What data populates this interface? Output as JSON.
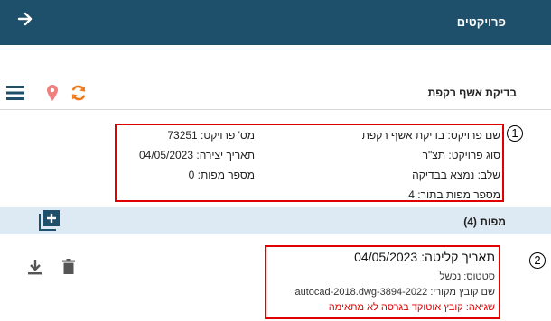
{
  "header": {
    "title": "פרויקטים",
    "nav_icon": "arrow-right-icon"
  },
  "project": {
    "title": "בדיקת אשף רקפת",
    "icons": [
      "menu-icon",
      "location-pin-icon",
      "refresh-icon"
    ]
  },
  "info": {
    "badge": "1",
    "name": "שם פרויקט: בדיקת אשף רקפת",
    "number": "מס' פרויקט: 73251",
    "type": "סוג פרויקט: תצ\"ר",
    "created": "תאריך יצירה: 04/05/2023",
    "stage": "שלב: נמצא בבדיקה",
    "maps_count": "מספר מפות: 0",
    "queued_maps": "מספר מפות בתור: 4"
  },
  "maps": {
    "label": "מפות (4)",
    "add_icon": "add-layer-icon"
  },
  "file": {
    "badge": "2",
    "date": "תאריך קליטה: 04/05/2023",
    "status": "סטטוס: נכשל",
    "source": "שם קובץ מקורי: autocad-2018.dwg-3894-2022",
    "error": "שגיאה: קובץ אוטוקד בגרסה לא מתאימה",
    "actions": [
      "download-icon",
      "trash-icon"
    ]
  },
  "colors": {
    "header_bg": "#1e4f6b",
    "accent_orange": "#f07c1e",
    "pin_red": "#f08080",
    "highlight_red": "#e00000",
    "maps_bar_bg": "#dde9f3",
    "icon_blue": "#1e4f6b",
    "error_text": "#e00000"
  }
}
